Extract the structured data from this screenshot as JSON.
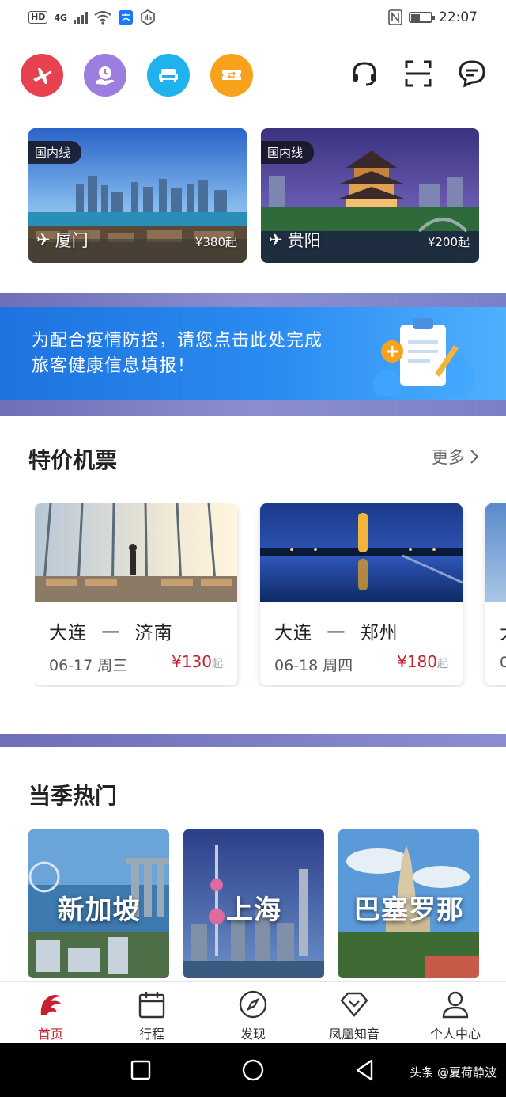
{
  "status_bar": {
    "left_chips": [
      "HD",
      "4G"
    ],
    "time": "22:07",
    "battery_level": 0.45
  },
  "top_icons": [
    {
      "icon": "plane-icon",
      "color": "#e8414f"
    },
    {
      "icon": "clock-hand-icon",
      "color": "#9b7ee0"
    },
    {
      "icon": "sofa-icon",
      "color": "#1fb2ec"
    },
    {
      "icon": "ticket-icon",
      "color": "#f7a21a"
    }
  ],
  "route_cards": [
    {
      "tag": "国内线",
      "city": "厦门",
      "price": "¥380起"
    },
    {
      "tag": "国内线",
      "city": "贵阳",
      "price": "¥200起"
    }
  ],
  "banner": {
    "line1": "为配合疫情防控，请您点击此处完成",
    "line2": "旅客健康信息填报！"
  },
  "specials": {
    "title": "特价机票",
    "more": "更多",
    "cards": [
      {
        "from": "大连",
        "to": "济南",
        "dash": "一",
        "date": "06-17 周三",
        "price": "¥130",
        "suffix": "起"
      },
      {
        "from": "大连",
        "to": "郑州",
        "dash": "一",
        "date": "06-18 周四",
        "price": "¥180",
        "suffix": "起"
      }
    ],
    "partial_card": {
      "from": "大",
      "date": "0"
    }
  },
  "hot": {
    "title": "当季热门",
    "cards": [
      {
        "label": "新加坡"
      },
      {
        "label": "上海"
      },
      {
        "label": "巴塞罗那"
      }
    ]
  },
  "tabs": [
    {
      "label": "首页",
      "icon": "phoenix-logo-icon",
      "active": true
    },
    {
      "label": "行程",
      "icon": "calendar-icon",
      "active": false
    },
    {
      "label": "发现",
      "icon": "compass-icon",
      "active": false
    },
    {
      "label": "凤凰知音",
      "icon": "diamond-icon",
      "active": false
    },
    {
      "label": "个人中心",
      "icon": "user-icon",
      "active": false
    }
  ],
  "watermark": "头条 @夏荷静波",
  "colors": {
    "accent_red": "#c8202f",
    "banner_blue": "#2a8cf0",
    "band_purple": "#7b7fc7"
  }
}
